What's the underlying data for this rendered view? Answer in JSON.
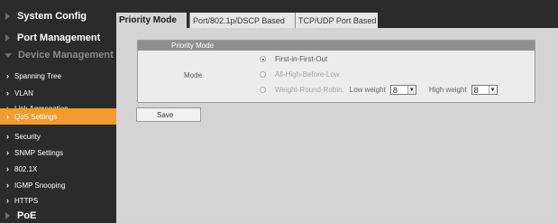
{
  "sidebar": {
    "top": [
      {
        "label": "System Config"
      },
      {
        "label": "Port Management"
      },
      {
        "label": "Device Management"
      }
    ],
    "sub": [
      {
        "label": "Spanning Tree"
      },
      {
        "label": "VLAN"
      },
      {
        "label": "Link Aggregation"
      },
      {
        "label": "QoS Settings"
      },
      {
        "label": "Security"
      },
      {
        "label": "SNMP Settings"
      },
      {
        "label": "802.1X"
      },
      {
        "label": "IGMP Snooping"
      },
      {
        "label": "HTTPS"
      }
    ],
    "bottom": {
      "label": "PoE"
    },
    "active_color": "#f39a2e"
  },
  "tabs": [
    {
      "label": "Priority Mode"
    },
    {
      "label": "Port/802.1p/DSCP Based"
    },
    {
      "label": "TCP/UDP Port Based"
    }
  ],
  "panel": {
    "title": "Priority Mode",
    "mode_label": "Mode",
    "options": [
      {
        "label": "First-in-First-Out"
      },
      {
        "label": "All-High-Before-Low"
      },
      {
        "label": "Weight-Round-Robin."
      }
    ],
    "low_weight_label": "Low weight",
    "low_weight_value": "8",
    "high_weight_label": "High weight",
    "high_weight_value": "8"
  },
  "save_label": "Save"
}
